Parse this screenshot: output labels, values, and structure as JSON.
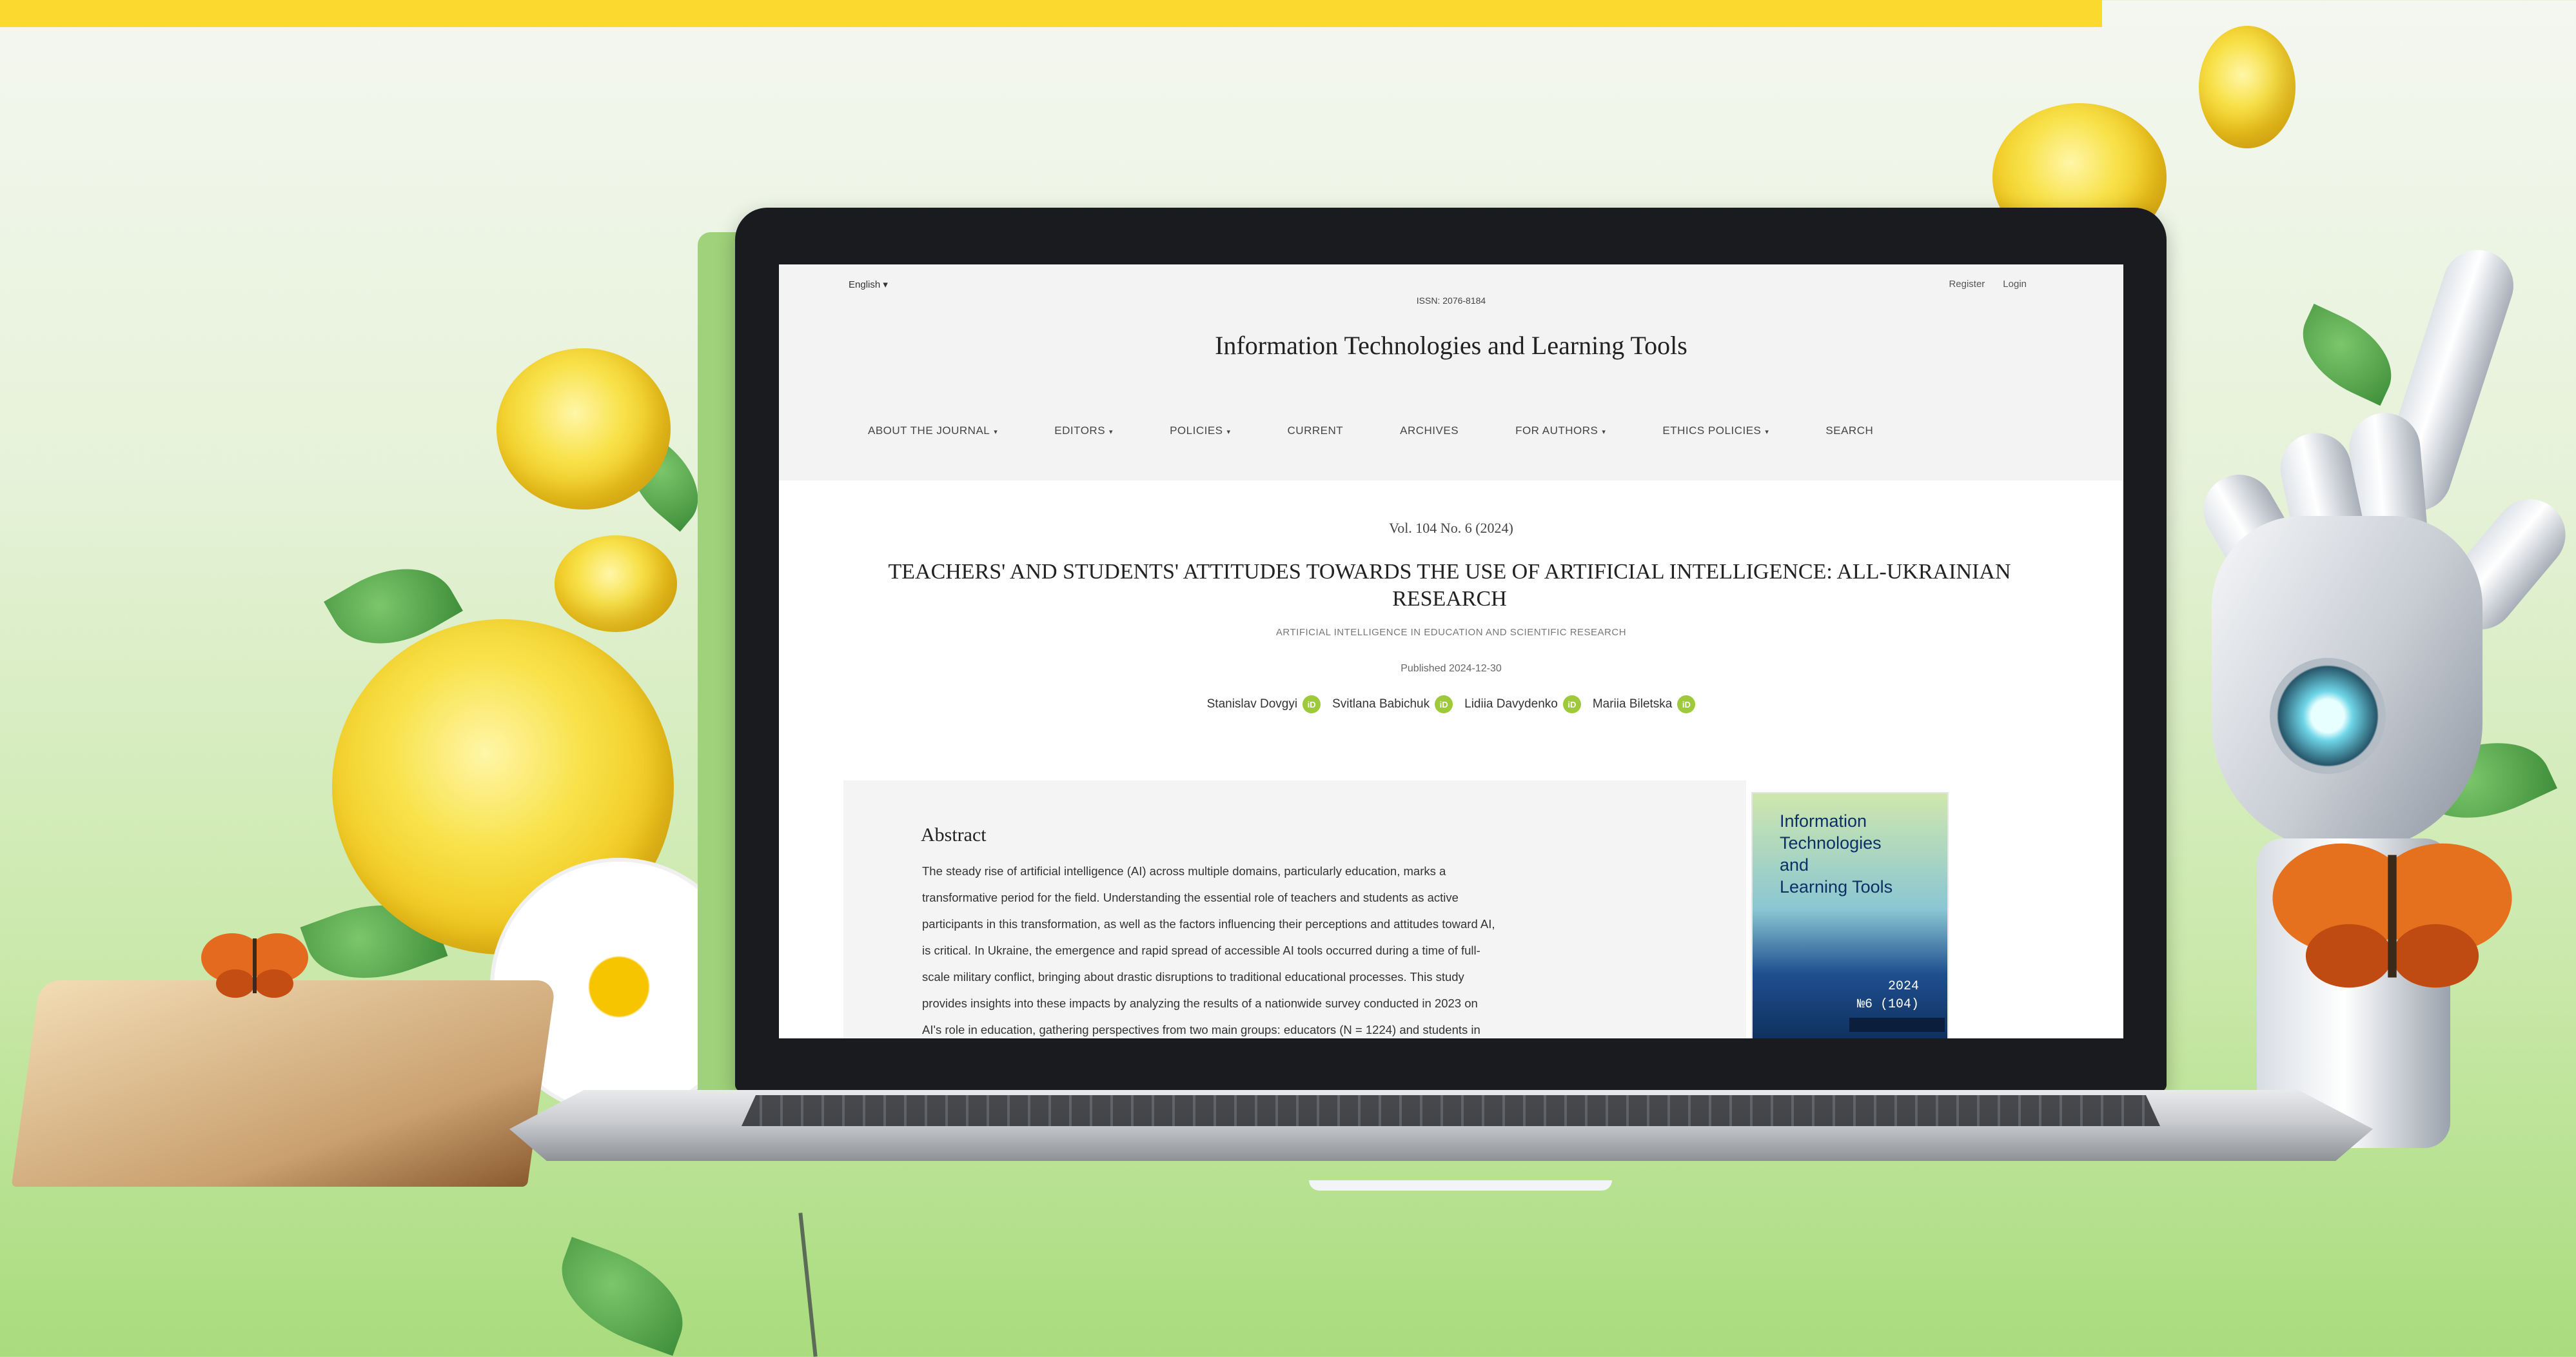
{
  "colors": {
    "top_bar": "#fbd92e",
    "accent_green": "#9dc93a"
  },
  "site": {
    "language": "English ▾",
    "register": "Register",
    "login": "Login",
    "issn": "ISSN: 2076-8184",
    "title": "Information Technologies and Learning Tools",
    "nav": [
      {
        "label": "ABOUT THE JOURNAL",
        "caret": "▾"
      },
      {
        "label": "EDITORS",
        "caret": "▾"
      },
      {
        "label": "POLICIES",
        "caret": "▾"
      },
      {
        "label": "CURRENT",
        "caret": ""
      },
      {
        "label": "ARCHIVES",
        "caret": ""
      },
      {
        "label": "FOR AUTHORS",
        "caret": "▾"
      },
      {
        "label": "ETHICS POLICIES",
        "caret": "▾"
      },
      {
        "label": "SEARCH",
        "caret": ""
      }
    ]
  },
  "article": {
    "volume": "Vol. 104 No. 6 (2024)",
    "title": "TEACHERS' AND STUDENTS' ATTITUDES TOWARDS THE USE OF ARTIFICIAL INTELLIGENCE: ALL-UKRAINIAN RESEARCH",
    "section": "ARTIFICIAL INTELLIGENCE IN EDUCATION AND SCIENTIFIC RESEARCH",
    "published": "Published 2024-12-30",
    "authors": [
      {
        "name": "Stanislav Dovgyi",
        "orcid": "iD"
      },
      {
        "name": "Svitlana Babichuk",
        "orcid": "iD"
      },
      {
        "name": "Lidiia Davydenko",
        "orcid": "iD"
      },
      {
        "name": "Mariia Biletska",
        "orcid": "iD"
      }
    ],
    "abstract_heading": "Abstract",
    "abstract_lines": [
      "The steady rise of artificial intelligence (AI) across multiple domains, particularly education, marks a",
      "transformative period for the field. Understanding the essential role of teachers and students as active",
      "participants in this transformation, as well as the factors influencing their perceptions and attitudes toward AI,",
      "is critical. In Ukraine, the emergence and rapid spread of accessible AI tools occurred during a time of full-",
      "scale military conflict, bringing about drastic disruptions to traditional educational processes. This study",
      "provides insights into these impacts by analyzing the results of a nationwide survey conducted in 2023 on",
      "AI's role in education, gathering perspectives from two main groups: educators (N = 1224) and students in"
    ],
    "cover": {
      "title_lines": [
        "Information",
        "Technologies",
        "and",
        "Learning Tools"
      ],
      "year": "2024",
      "number": "№6 (104)"
    }
  },
  "decorations": {
    "icons": [
      "yellow-rose-icon",
      "white-cosmos-icon",
      "butterfly-icon",
      "open-book-icon",
      "robot-hand-icon",
      "leaf-icon"
    ]
  }
}
